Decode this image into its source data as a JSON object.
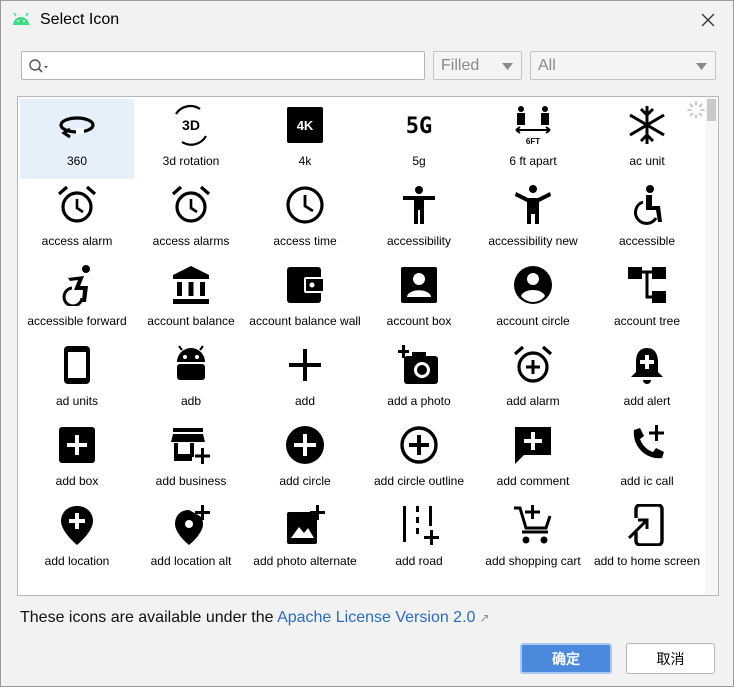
{
  "window": {
    "title": "Select Icon"
  },
  "search": {
    "value": "",
    "placeholder": ""
  },
  "style_combo": {
    "selected": "Filled"
  },
  "category_combo": {
    "selected": "All"
  },
  "icons": [
    {
      "label": "360",
      "icon": "rotate-360-icon"
    },
    {
      "label": "3d rotation",
      "icon": "3d-rotation-icon"
    },
    {
      "label": "4k",
      "icon": "4k-icon"
    },
    {
      "label": "5g",
      "icon": "5g-icon"
    },
    {
      "label": "6 ft apart",
      "icon": "6-ft-apart-icon"
    },
    {
      "label": "ac unit",
      "icon": "ac-unit-icon"
    },
    {
      "label": "access alarm",
      "icon": "access-alarm-icon"
    },
    {
      "label": "access alarms",
      "icon": "access-alarms-icon"
    },
    {
      "label": "access time",
      "icon": "access-time-icon"
    },
    {
      "label": "accessibility",
      "icon": "accessibility-icon"
    },
    {
      "label": "accessibility new",
      "icon": "accessibility-new-icon"
    },
    {
      "label": "accessible",
      "icon": "accessible-icon"
    },
    {
      "label": "accessible forward",
      "icon": "accessible-forward-icon"
    },
    {
      "label": "account balance",
      "icon": "account-balance-icon"
    },
    {
      "label": "account balance wall",
      "icon": "account-balance-wallet-icon"
    },
    {
      "label": "account box",
      "icon": "account-box-icon"
    },
    {
      "label": "account circle",
      "icon": "account-circle-icon"
    },
    {
      "label": "account tree",
      "icon": "account-tree-icon"
    },
    {
      "label": "ad units",
      "icon": "ad-units-icon"
    },
    {
      "label": "adb",
      "icon": "adb-icon"
    },
    {
      "label": "add",
      "icon": "add-icon"
    },
    {
      "label": "add a photo",
      "icon": "add-a-photo-icon"
    },
    {
      "label": "add alarm",
      "icon": "add-alarm-icon"
    },
    {
      "label": "add alert",
      "icon": "add-alert-icon"
    },
    {
      "label": "add box",
      "icon": "add-box-icon"
    },
    {
      "label": "add business",
      "icon": "add-business-icon"
    },
    {
      "label": "add circle",
      "icon": "add-circle-icon"
    },
    {
      "label": "add circle outline",
      "icon": "add-circle-outline-icon"
    },
    {
      "label": "add comment",
      "icon": "add-comment-icon"
    },
    {
      "label": "add ic call",
      "icon": "add-ic-call-icon"
    },
    {
      "label": "add location",
      "icon": "add-location-icon"
    },
    {
      "label": "add location alt",
      "icon": "add-location-alt-icon"
    },
    {
      "label": "add photo alternate",
      "icon": "add-photo-alternate-icon"
    },
    {
      "label": "add road",
      "icon": "add-road-icon"
    },
    {
      "label": "add shopping cart",
      "icon": "add-shopping-cart-icon"
    },
    {
      "label": "add to home screen",
      "icon": "add-to-home-screen-icon"
    }
  ],
  "footer": {
    "prefix": "These icons are available under the ",
    "link": "Apache License Version 2.0",
    "link_arrow": "↗"
  },
  "buttons": {
    "ok": "确定",
    "cancel": "取消"
  },
  "colors": {
    "accent": "#4a89dc",
    "link": "#2a6cc4",
    "selection": "#e6f0fb",
    "android_green": "#3ddc84"
  }
}
